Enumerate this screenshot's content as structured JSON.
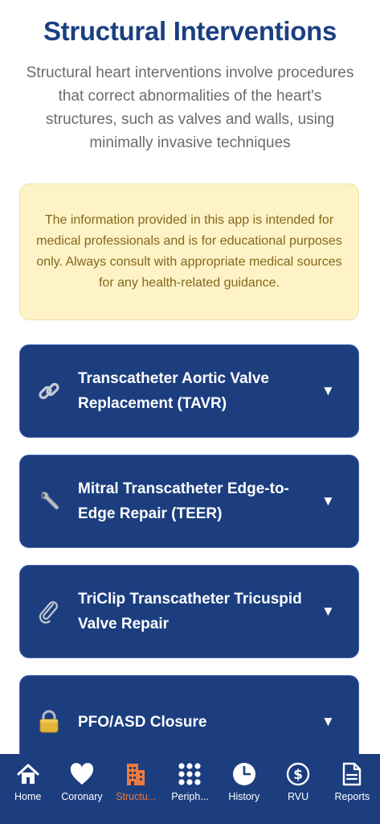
{
  "header": {
    "title": "Structural Interventions",
    "subtitle": "Structural heart interventions involve procedures that correct abnormalities of the heart's structures, such as valves and walls, using minimally invasive techniques"
  },
  "disclaimer": {
    "text": "The information provided in this app is intended for medical professionals and is for educational purposes only. Always consult with appropriate medical sources for any health-related guidance."
  },
  "procedures": [
    {
      "label": "Transcatheter Aortic Valve Replacement (TAVR)",
      "icon": "link-icon",
      "chevron": "▼"
    },
    {
      "label": "Mitral Transcatheter Edge-to-Edge Repair (TEER)",
      "icon": "wrench-icon",
      "chevron": "▼"
    },
    {
      "label": "TriClip Transcatheter Tricuspid Valve Repair",
      "icon": "paperclip-icon",
      "chevron": "▼"
    },
    {
      "label": "PFO/ASD Closure",
      "icon": "lock-icon",
      "chevron": "▼"
    }
  ],
  "tabbar": {
    "active_index": 2,
    "tabs": [
      {
        "label": "Home",
        "icon": "home-icon"
      },
      {
        "label": "Coronary",
        "icon": "heart-icon"
      },
      {
        "label": "Structu...",
        "icon": "building-icon"
      },
      {
        "label": "Periph...",
        "icon": "grid-icon"
      },
      {
        "label": "History",
        "icon": "clock-icon"
      },
      {
        "label": "RVU",
        "icon": "dollar-icon"
      },
      {
        "label": "Reports",
        "icon": "document-icon"
      }
    ]
  },
  "colors": {
    "brand": "#1c3e7f",
    "active_tab": "#ed7a3d",
    "disclaimer_bg": "#fdf3c6",
    "disclaimer_text": "#86671b"
  }
}
